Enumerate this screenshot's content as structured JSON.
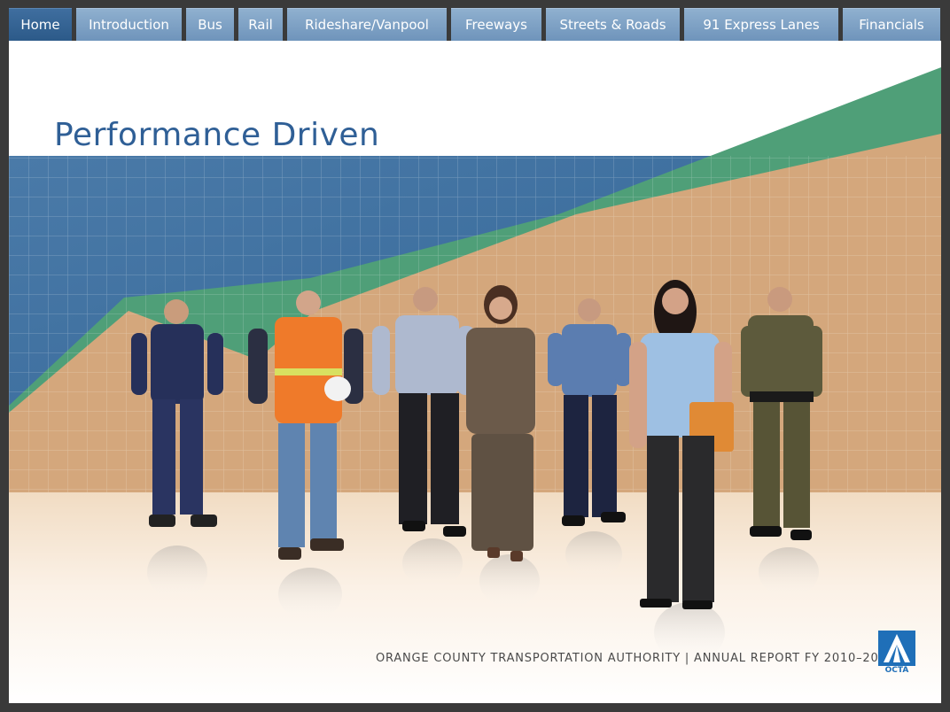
{
  "nav": {
    "items": [
      {
        "label": "Home",
        "active": true
      },
      {
        "label": "Introduction",
        "active": false
      },
      {
        "label": "Bus",
        "active": false
      },
      {
        "label": "Rail",
        "active": false
      },
      {
        "label": "Rideshare/Vanpool",
        "active": false
      },
      {
        "label": "Freeways",
        "active": false
      },
      {
        "label": "Streets & Roads",
        "active": false
      },
      {
        "label": "91 Express Lanes",
        "active": false
      },
      {
        "label": "Financials",
        "active": false
      }
    ]
  },
  "page": {
    "title": "Performance Driven",
    "footer": "ORANGE COUNTY TRANSPORTATION AUTHORITY  |  ANNUAL REPORT FY 2010–2011",
    "logo_text": "OCTA"
  },
  "colors": {
    "nav_active": "#2f5f91",
    "nav_inactive": "#7c9fc4",
    "title": "#2f5f96",
    "band_blue": "#3f6f9e",
    "band_green": "#4f9f78",
    "band_tan": "#d4a77c",
    "logo_blue": "#1f6fb8"
  }
}
